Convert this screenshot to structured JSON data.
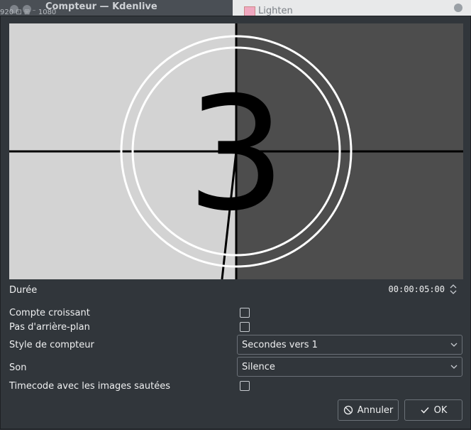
{
  "background": {
    "window_title": "Compteur — Kdenlive",
    "left_fragment": "920 ⊡ ⊞ ⁻ 1080",
    "right_item": "Lighten"
  },
  "preview": {
    "digit": "3",
    "left_color": "#d3d3d3",
    "right_color": "#4d4d4d"
  },
  "form": {
    "duration_label": "Durée",
    "duration_value": "00:00:05:00",
    "count_up_label": "Compte croissant",
    "no_background_label": "Pas d'arrière-plan",
    "style_label": "Style de compteur",
    "style_value": "Secondes vers 1",
    "sound_label": "Son",
    "sound_value": "Silence",
    "timecode_label": "Timecode avec les images sautées"
  },
  "buttons": {
    "cancel_label": "Annuler",
    "ok_label": "OK"
  },
  "icons": {
    "cancel": "cancel-icon",
    "ok": "checkmark-icon",
    "spin": "spin-arrows-icon",
    "dropdown": "chevron-down-icon"
  }
}
